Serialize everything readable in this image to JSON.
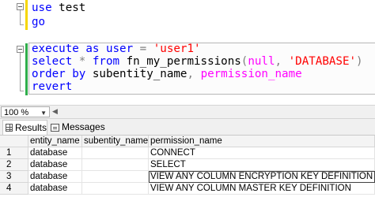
{
  "editor": {
    "lines": {
      "l1": {
        "kw": "use",
        "tx": " test"
      },
      "l2": {
        "kw": "go"
      },
      "l3": {
        "kw": "execute as user",
        "op": " = ",
        "str": "'user1'"
      },
      "l4": {
        "kw": "select",
        "op1": " * ",
        "kw2": "from",
        "tx": " fn_my_permissions",
        "op2": "(",
        "fn": "null",
        "op3": ", ",
        "str": "'DATABASE'",
        "op4": ")"
      },
      "l5": {
        "kw": "order by",
        "tx": " subentity_name",
        "op": ", ",
        "fn": "permission_name"
      },
      "l6": {
        "kw": "revert"
      }
    }
  },
  "zoom": {
    "value": "100 %"
  },
  "tabs": {
    "results": "Results",
    "messages": "Messages"
  },
  "grid": {
    "columns": [
      "entity_name",
      "subentity_name",
      "permission_name"
    ],
    "rows": [
      {
        "num": "1",
        "entity_name": "database",
        "subentity_name": "",
        "permission_name": "CONNECT"
      },
      {
        "num": "2",
        "entity_name": "database",
        "subentity_name": "",
        "permission_name": "SELECT"
      },
      {
        "num": "3",
        "entity_name": "database",
        "subentity_name": "",
        "permission_name": "VIEW ANY COLUMN ENCRYPTION KEY DEFINITION"
      },
      {
        "num": "4",
        "entity_name": "database",
        "subentity_name": "",
        "permission_name": "VIEW ANY COLUMN MASTER KEY DEFINITION"
      }
    ]
  }
}
